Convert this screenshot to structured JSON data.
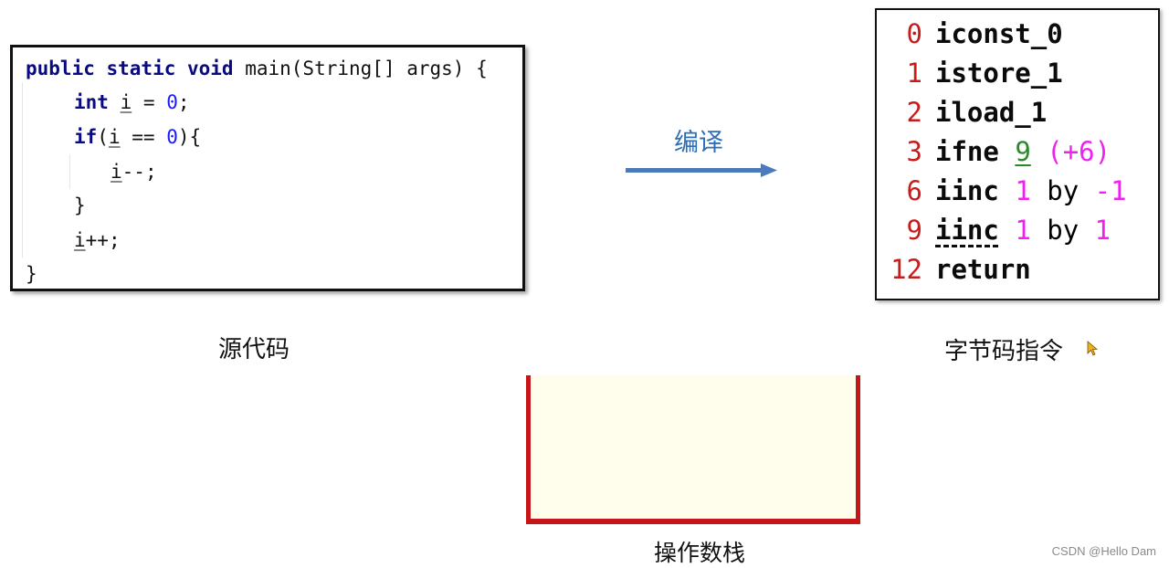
{
  "source_code": {
    "caption": "源代码",
    "lines": [
      {
        "kw1": "public static void",
        "rest": " main(String[] args) {"
      },
      {
        "kw": "int",
        "sp": " ",
        "var": "i",
        "mid": " = ",
        "num": "0",
        "end": ";"
      },
      {
        "kw": "if",
        "open": "(",
        "var": "i",
        "mid": " == ",
        "num": "0",
        "end": "){"
      },
      {
        "var": "i",
        "end": "--;"
      },
      {
        "text": "}"
      },
      {
        "var": "i",
        "end": "++;"
      },
      {
        "text": "}"
      }
    ]
  },
  "compile_arrow": {
    "label": "编译",
    "icon": "right-arrow-icon",
    "color": "#4a7bbd"
  },
  "bytecode": {
    "caption": "字节码指令",
    "instructions": [
      {
        "index": "0",
        "op": "iconst_0"
      },
      {
        "index": "1",
        "op": "istore_1"
      },
      {
        "index": "2",
        "op": "iload_1"
      },
      {
        "index": "3",
        "op": "ifne",
        "target": "9",
        "offset": "(+6)"
      },
      {
        "index": "6",
        "op": "iinc",
        "a": "1",
        "by": "by",
        "b": "-1"
      },
      {
        "index": "9",
        "op": "iinc",
        "a": "1",
        "by": "by",
        "b": "1"
      },
      {
        "index": "12",
        "op": "return"
      }
    ]
  },
  "operand_stack": {
    "caption": "操作数栈",
    "border_color": "#c7161a",
    "fill_color": "#fffdeb"
  },
  "watermark": "CSDN @Hello Dam",
  "cursor": "pointer-cursor-icon"
}
